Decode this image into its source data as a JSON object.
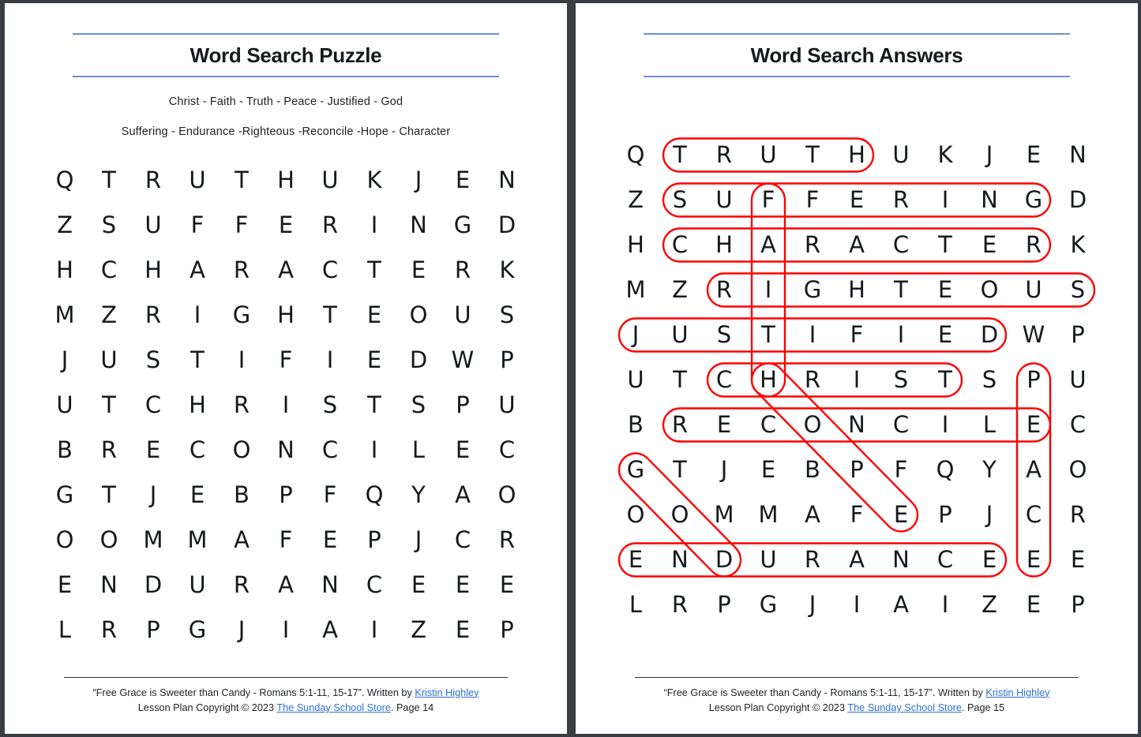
{
  "meta": {
    "columns": 13,
    "rows": 11,
    "accent_rule_color": "#6a8fd6",
    "answer_mark_color": "#ff0000",
    "link_color": "#2e6fd4",
    "page_background": "#ffffff",
    "spread_background": "#3a3d42"
  },
  "left_page": {
    "title": "Word Search Puzzle",
    "wordlist": {
      "line1": "Christ - Faith - Truth - Peace - Justified - God",
      "line2": "Suffering - Endurance -Righteous -Reconcile -Hope - Character"
    },
    "footer": {
      "line1_before": "“Free Grace is Sweeter than Candy - Romans 5:1-11, 15-17”.  Written by ",
      "line1_link": "Kristin Highley",
      "line2_before": "Lesson Plan Copyright © 2023 ",
      "line2_link": "The Sunday School Store",
      "line2_after": ". Page 14"
    }
  },
  "right_page": {
    "title": "Word Search Answers",
    "footer": {
      "line1_before": "“Free Grace is Sweeter than Candy - Romans 5:1-11, 15-17”.  Written by ",
      "line1_link": "Kristin Highley",
      "line2_before": "Lesson Plan Copyright © 2023 ",
      "line2_link": "The Sunday School Store",
      "line2_after": ". Page 15"
    }
  },
  "puzzle": {
    "words": [
      "Christ",
      "Faith",
      "Truth",
      "Peace",
      "Justified",
      "God",
      "Suffering",
      "Endurance",
      "Righteous",
      "Reconcile",
      "Hope",
      "Character"
    ],
    "grid": [
      [
        "Q",
        "T",
        "R",
        "U",
        "T",
        "H",
        "U",
        "K",
        "J",
        "E",
        "N",
        "",
        ""
      ],
      [
        "Z",
        "S",
        "U",
        "F",
        "F",
        "E",
        "R",
        "I",
        "N",
        "G",
        "D",
        "",
        ""
      ],
      [
        "H",
        "C",
        "H",
        "A",
        "R",
        "A",
        "C",
        "T",
        "E",
        "R",
        "K",
        "",
        ""
      ],
      [
        "M",
        "Z",
        "R",
        "I",
        "G",
        "H",
        "T",
        "E",
        "O",
        "U",
        "S",
        "",
        ""
      ],
      [
        "J",
        "U",
        "S",
        "T",
        "I",
        "F",
        "I",
        "E",
        "D",
        "W",
        "P",
        "",
        ""
      ],
      [
        "U",
        "T",
        "C",
        "H",
        "R",
        "I",
        "S",
        "T",
        "S",
        "P",
        "U",
        "",
        ""
      ],
      [
        "B",
        "R",
        "E",
        "C",
        "O",
        "N",
        "C",
        "I",
        "L",
        "E",
        "C",
        "",
        ""
      ],
      [
        "G",
        "T",
        "J",
        "E",
        "B",
        "P",
        "F",
        "Q",
        "Y",
        "A",
        "O",
        "",
        ""
      ],
      [
        "O",
        "O",
        "M",
        "M",
        "A",
        "F",
        "E",
        "P",
        "J",
        "C",
        "R",
        "",
        ""
      ],
      [
        "E",
        "N",
        "D",
        "U",
        "R",
        "A",
        "N",
        "C",
        "E",
        "E",
        "E",
        "",
        ""
      ],
      [
        "L",
        "R",
        "P",
        "G",
        "J",
        "I",
        "A",
        "I",
        "Z",
        "E",
        "P",
        "",
        ""
      ]
    ],
    "answers": [
      {
        "word": "TRUTH",
        "shape": "horizontal",
        "row": 0,
        "col_start": 1,
        "col_end": 5
      },
      {
        "word": "SUFFERING",
        "shape": "horizontal",
        "row": 1,
        "col_start": 1,
        "col_end": 9
      },
      {
        "word": "CHARACTER",
        "shape": "horizontal",
        "row": 2,
        "col_start": 1,
        "col_end": 9
      },
      {
        "word": "RIGHTEOUS",
        "shape": "horizontal",
        "row": 3,
        "col_start": 2,
        "col_end": 10
      },
      {
        "word": "JUSTIFIED",
        "shape": "horizontal",
        "row": 4,
        "col_start": 0,
        "col_end": 8
      },
      {
        "word": "CHRIST",
        "shape": "horizontal",
        "row": 5,
        "col_start": 2,
        "col_end": 7
      },
      {
        "word": "RECONCILE",
        "shape": "horizontal",
        "row": 6,
        "col_start": 1,
        "col_end": 9
      },
      {
        "word": "ENDURANCE",
        "shape": "horizontal",
        "row": 9,
        "col_start": 0,
        "col_end": 8
      },
      {
        "word": "FAITH",
        "shape": "vertical",
        "col": 3,
        "row_start": 1,
        "row_end": 5
      },
      {
        "word": "PEACE",
        "shape": "vertical",
        "col": 9,
        "row_start": 5,
        "row_end": 9
      },
      {
        "word": "GOD",
        "shape": "diagonal",
        "row_start": 7,
        "col_start": 0,
        "row_end": 9,
        "col_end": 2
      },
      {
        "word": "HOPE",
        "shape": "diagonal",
        "row_start": 5,
        "col_start": 3,
        "row_end": 8,
        "col_end": 6
      }
    ]
  }
}
